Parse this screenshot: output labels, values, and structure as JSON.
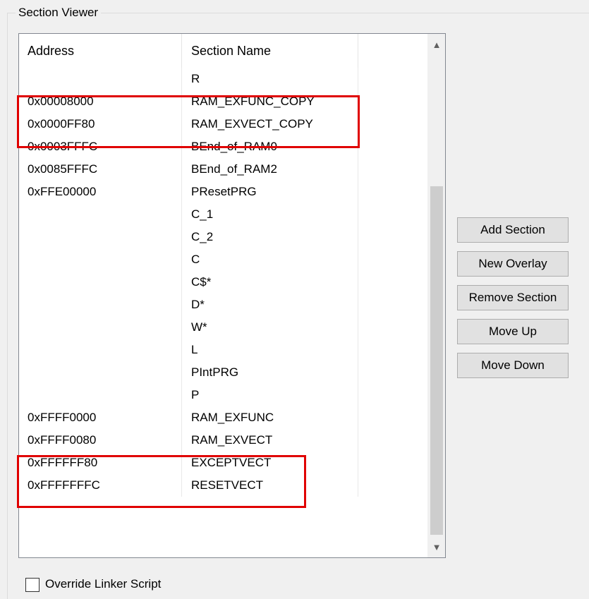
{
  "group": {
    "title": "Section Viewer"
  },
  "table": {
    "columns": [
      "Address",
      "Section Name",
      ""
    ],
    "rows": [
      {
        "address": "",
        "name": "R"
      },
      {
        "address": "0x00008000",
        "name": "RAM_EXFUNC_COPY"
      },
      {
        "address": "0x0000FF80",
        "name": "RAM_EXVECT_COPY"
      },
      {
        "address": "0x0003FFFC",
        "name": "BEnd_of_RAM0"
      },
      {
        "address": "0x0085FFFC",
        "name": "BEnd_of_RAM2"
      },
      {
        "address": "0xFFE00000",
        "name": "PResetPRG"
      },
      {
        "address": "",
        "name": "C_1"
      },
      {
        "address": "",
        "name": "C_2"
      },
      {
        "address": "",
        "name": "C"
      },
      {
        "address": "",
        "name": "C$*"
      },
      {
        "address": "",
        "name": "D*"
      },
      {
        "address": "",
        "name": "W*"
      },
      {
        "address": "",
        "name": "L"
      },
      {
        "address": "",
        "name": "PIntPRG"
      },
      {
        "address": "",
        "name": "P"
      },
      {
        "address": "0xFFFF0000",
        "name": "RAM_EXFUNC"
      },
      {
        "address": "0xFFFF0080",
        "name": "RAM_EXVECT"
      },
      {
        "address": "0xFFFFFF80",
        "name": "EXCEPTVECT"
      },
      {
        "address": "0xFFFFFFFC",
        "name": "RESETVECT"
      }
    ]
  },
  "buttons": {
    "add_section": "Add Section",
    "new_overlay": "New Overlay",
    "remove_section": "Remove Section",
    "move_up": "Move Up",
    "move_down": "Move Down"
  },
  "checkbox": {
    "label": "Override Linker Script",
    "checked": false
  },
  "scrollbar": {
    "up_icon": "chevron-up-icon",
    "down_icon": "chevron-down-icon"
  },
  "highlight_color": "#e00000"
}
